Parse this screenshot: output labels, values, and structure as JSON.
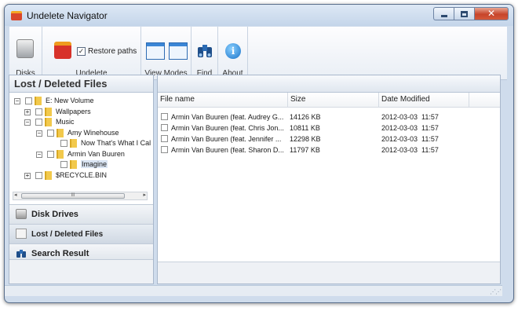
{
  "window": {
    "title": "Undelete Navigator"
  },
  "ribbon": {
    "disks_label": "Disks",
    "undelete_label": "Undelete",
    "restore_paths_label": "Restore paths",
    "restore_paths_checked": true,
    "view_modes_label": "View Modes",
    "find_label": "Find",
    "about_label": "About",
    "about_glyph": "i"
  },
  "left_panel": {
    "title": "Lost / Deleted Files",
    "tree": [
      {
        "label": "E: New Volume",
        "expander": "⊟"
      },
      {
        "label": "Wallpapers",
        "expander": "⊞"
      },
      {
        "label": "Music",
        "expander": "⊟"
      },
      {
        "label": "Amy Winehouse",
        "expander": "⊟"
      },
      {
        "label": "Now That's What I Cal",
        "expander": ""
      },
      {
        "label": "Armin Van Buuren",
        "expander": "⊟"
      },
      {
        "label": "Imagine",
        "expander": "",
        "selected": true
      },
      {
        "label": "$RECYCLE.BIN",
        "expander": "⊞"
      }
    ],
    "scroll_thumb": "III",
    "nav": {
      "disk_drives": "Disk Drives",
      "lost_deleted": "Lost / Deleted Files",
      "search_result": "Search Result"
    }
  },
  "file_list": {
    "columns": {
      "name": "File name",
      "size": "Size",
      "date": "Date Modified"
    },
    "rows": [
      {
        "name": "Armin Van Buuren (feat. Audrey G...",
        "size": "14126 KB",
        "date": "2012-03-03  11:57"
      },
      {
        "name": "Armin Van Buuren (feat. Chris Jon...",
        "size": "10811 KB",
        "date": "2012-03-03  11:57"
      },
      {
        "name": "Armin Van Buuren (feat. Jennifer ...",
        "size": "12298 KB",
        "date": "2012-03-03  11:57"
      },
      {
        "name": "Armin Van Buuren (feat. Sharon D...",
        "size": "11797 KB",
        "date": "2012-03-03  11:57"
      }
    ]
  },
  "colors": {
    "accent": "#3b86d6",
    "folder": "#f2c94c",
    "close": "#c7442a"
  }
}
